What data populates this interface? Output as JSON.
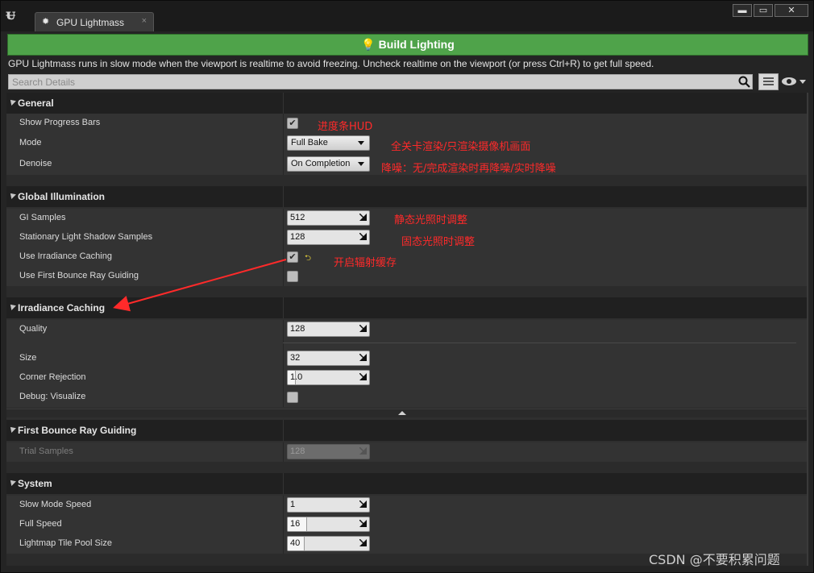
{
  "window": {
    "tab_title": "GPU Lightmass",
    "tab_close": "×",
    "minimize": "▬",
    "maximize": "▭",
    "close": "✕"
  },
  "build": {
    "label": "Build Lighting",
    "notice": "GPU Lightmass runs in slow mode when the viewport is realtime to avoid freezing. Uncheck realtime on the viewport (or press Ctrl+R) to get full speed."
  },
  "search": {
    "placeholder": "Search Details"
  },
  "categories": {
    "general": {
      "title": "General",
      "show_progress_bars": {
        "label": "Show Progress Bars",
        "checked": true
      },
      "mode": {
        "label": "Mode",
        "value": "Full Bake"
      },
      "denoise": {
        "label": "Denoise",
        "value": "On Completion"
      }
    },
    "gi": {
      "title": "Global Illumination",
      "gi_samples": {
        "label": "GI Samples",
        "value": "512"
      },
      "shadow_samples": {
        "label": "Stationary Light Shadow Samples",
        "value": "128"
      },
      "irradiance_caching": {
        "label": "Use Irradiance Caching",
        "checked": true
      },
      "first_bounce": {
        "label": "Use First Bounce Ray Guiding",
        "checked": false
      }
    },
    "irradiance": {
      "title": "Irradiance Caching",
      "quality": {
        "label": "Quality",
        "value": "128"
      },
      "size": {
        "label": "Size",
        "value": "32"
      },
      "corner_rejection": {
        "label": "Corner Rejection",
        "value": "1.0"
      },
      "debug_visualize": {
        "label": "Debug: Visualize",
        "checked": false
      }
    },
    "fbrg": {
      "title": "First Bounce Ray Guiding",
      "trial_samples": {
        "label": "Trial Samples",
        "value": "128"
      }
    },
    "system": {
      "title": "System",
      "slow_mode_speed": {
        "label": "Slow Mode Speed",
        "value": "1"
      },
      "full_speed": {
        "label": "Full Speed",
        "value": "16"
      },
      "tile_pool_size": {
        "label": "Lightmap Tile Pool Size",
        "value": "40"
      }
    }
  },
  "annotations": {
    "progress": "进度条HUD",
    "mode": "全关卡渲染/只渲染摄像机画面",
    "denoise": "降噪：无/完成渲染时再降噪/实时降噪",
    "gi_samples": "静态光照时调整",
    "shadow_samples": "固态光照时调整",
    "irradiance": "开启辐射缓存"
  },
  "watermark": "CSDN @不要积累问题",
  "colors": {
    "build_green": "#4fa34a",
    "annotation_red": "#ff2a2a",
    "panel_bg": "#2f2f2f",
    "category_bg": "#202020"
  }
}
